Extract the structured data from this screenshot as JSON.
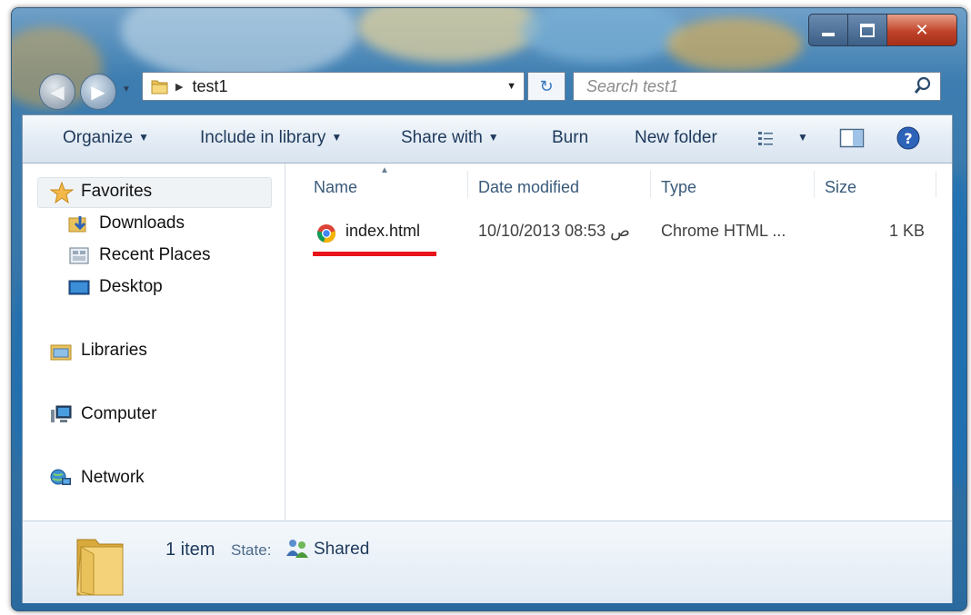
{
  "window": {
    "caption_buttons": {
      "minimize": "minimize-icon",
      "maximize": "maximize-icon",
      "close": "close-icon"
    }
  },
  "navigation": {
    "address_path": "test1",
    "search_placeholder": "Search test1"
  },
  "toolbar": {
    "organize": "Organize",
    "include_in_library": "Include in library",
    "share_with": "Share with",
    "burn": "Burn",
    "new_folder": "New folder"
  },
  "nav_pane": {
    "favorites": "Favorites",
    "downloads": "Downloads",
    "recent_places": "Recent Places",
    "desktop": "Desktop",
    "libraries": "Libraries",
    "computer": "Computer",
    "network": "Network"
  },
  "file_list": {
    "columns": {
      "name": "Name",
      "date_modified": "Date modified",
      "type": "Type",
      "size": "Size"
    },
    "rows": [
      {
        "name": "index.html",
        "date_modified": "10/10/2013 08:53 ص",
        "type": "Chrome HTML ...",
        "size": "1 KB"
      }
    ]
  },
  "details": {
    "count": "1 item",
    "state_label": "State:",
    "state_value": "Shared"
  },
  "colors": {
    "highlight": "#e8141a",
    "link_text": "#1e395b"
  }
}
